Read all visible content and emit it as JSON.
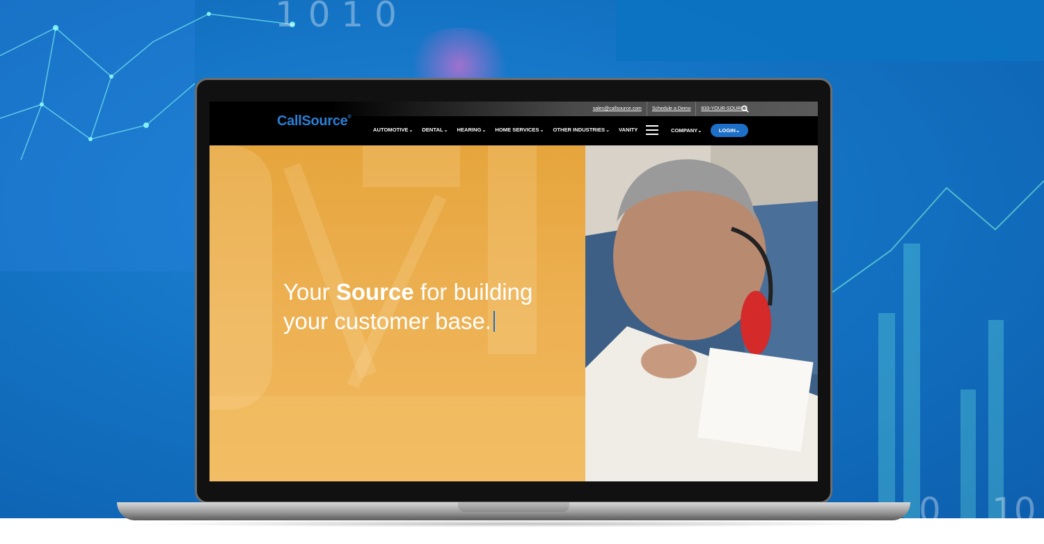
{
  "top_bar": {
    "email": "sales@callsource.com",
    "demo": "Schedule a Demo",
    "phone": "833-YOUR-SOURCE"
  },
  "brand": {
    "name": "CallSource",
    "mark": "®"
  },
  "nav": {
    "items": [
      {
        "label": "AUTOMOTIVE",
        "dropdown": true
      },
      {
        "label": "DENTAL",
        "dropdown": true
      },
      {
        "label": "HEARING",
        "dropdown": true
      },
      {
        "label": "HOME SERVICES",
        "dropdown": true
      },
      {
        "label": "OTHER INDUSTRIES",
        "dropdown": true
      },
      {
        "label": "VANITY",
        "dropdown": false
      }
    ],
    "company": "COMPANY",
    "login": "LOGIN",
    "chevron": "⌄"
  },
  "hero": {
    "line1_pre": "Your ",
    "line1_bold": "Source",
    "line1_post": " for building",
    "line2": "your customer base."
  },
  "background": {
    "digits_top": "1 0 1 0",
    "digits_bottom_a": "0",
    "digits_bottom_b": "10"
  },
  "colors": {
    "brand_blue": "#2b7fd6",
    "login_blue": "#1e6fc7",
    "hero_gold": "#e6a53c"
  }
}
